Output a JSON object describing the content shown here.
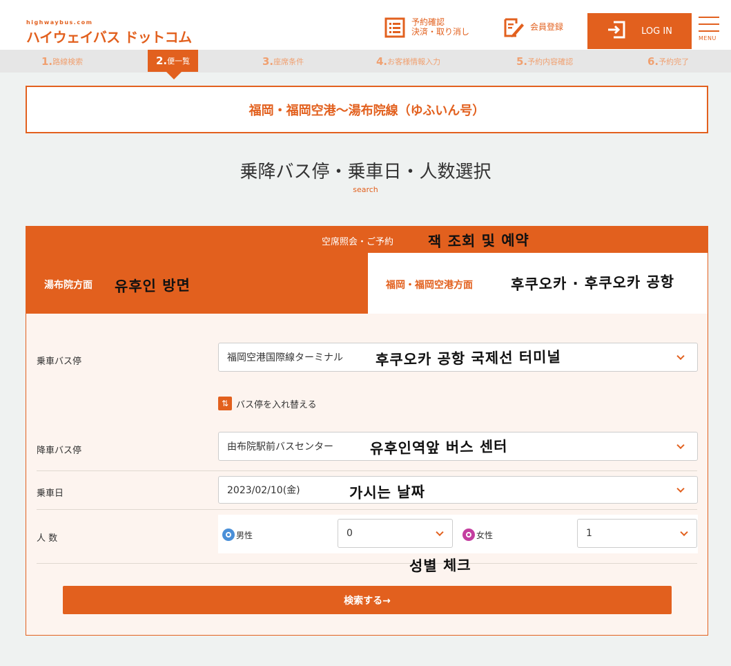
{
  "header": {
    "logo_small": "highwaybus.com",
    "logo_main": "ハイウェイバス ドットコム",
    "reserve_line1": "予約確認",
    "reserve_line2": "決済・取り消し",
    "member_label": "会員登録",
    "login_label": "LOG IN",
    "menu_label": "MENU"
  },
  "steps": [
    {
      "num": "1.",
      "label": "路線検索"
    },
    {
      "num": "2.",
      "label": "便一覧"
    },
    {
      "num": "3.",
      "label": "座席条件"
    },
    {
      "num": "4.",
      "label": "お客様情報入力"
    },
    {
      "num": "5.",
      "label": "予約内容確認"
    },
    {
      "num": "6.",
      "label": "予約完了"
    }
  ],
  "route_title": "福岡・福岡空港〜湯布院線（ゆふいん号）",
  "section": {
    "title": "乗降バス停・乗車日・人数選択",
    "subtitle": "search"
  },
  "card": {
    "header": "空席照会・ご予約",
    "tab_left": "湯布院方面",
    "tab_right": "福岡・福岡空港方面"
  },
  "form": {
    "boarding_label": "乗車バス停",
    "boarding_value": "福岡空港国際線ターミナル",
    "swap_label": "バス停を入れ替える",
    "alighting_label": "降車バス停",
    "alighting_value": "由布院駅前バスセンター",
    "date_label": "乗車日",
    "date_value": "2023/02/10(金)",
    "people_label": "人 数",
    "male_label": "男性",
    "male_value": "0",
    "female_label": "女性",
    "female_value": "1",
    "search_button": "検索する→"
  },
  "annotations": {
    "card_header": "잭 조회 및 예약",
    "tab_left": "유후인 방면",
    "tab_right": "후쿠오카 · 후쿠오카 공항",
    "boarding": "후쿠오카 공항 국제선 터미널",
    "alighting": "유후인역앞 버스 센터",
    "date": "가시는 날짜",
    "people": "성별 체크"
  },
  "colors": {
    "accent": "#e2601e",
    "background": "#eff2f1",
    "male_icon": "#4a8fd8",
    "female_icon": "#c43ea0"
  }
}
